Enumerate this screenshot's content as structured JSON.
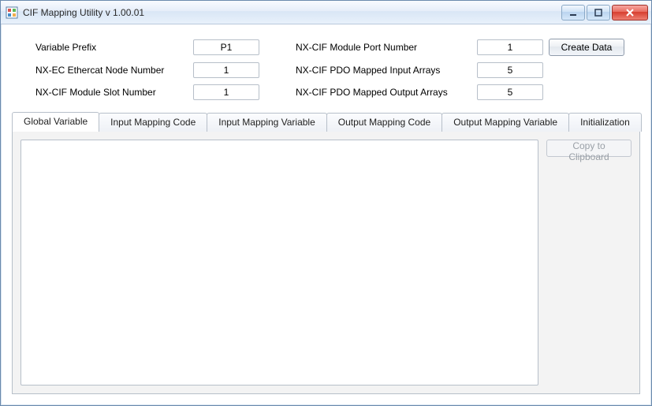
{
  "window": {
    "title": "CIF Mapping Utility v 1.00.01"
  },
  "form": {
    "left": [
      {
        "label": "Variable Prefix",
        "value": "P1"
      },
      {
        "label": "NX-EC Ethercat Node Number",
        "value": "1"
      },
      {
        "label": "NX-CIF Module Slot Number",
        "value": "1"
      }
    ],
    "right": [
      {
        "label": "NX-CIF Module Port Number",
        "value": "1"
      },
      {
        "label": "NX-CIF PDO Mapped Input Arrays",
        "value": "5"
      },
      {
        "label": "NX-CIF PDO Mapped Output Arrays",
        "value": "5"
      }
    ],
    "create_button": "Create Data"
  },
  "tabs": [
    "Global Variable",
    "Input Mapping Code",
    "Input Mapping Variable",
    "Output Mapping Code",
    "Output Mapping Variable",
    "Initialization"
  ],
  "active_tab_index": 0,
  "panel": {
    "copy_button": "Copy to Clipboard"
  }
}
